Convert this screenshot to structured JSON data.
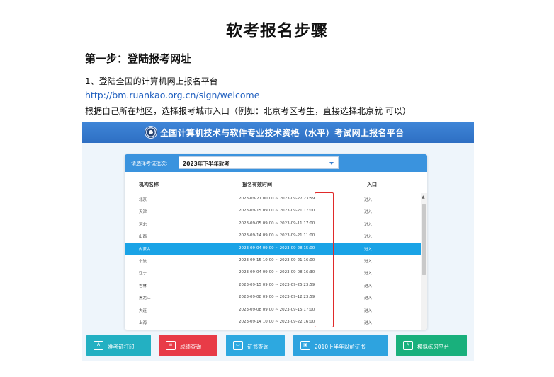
{
  "doc": {
    "title": "软考报名步骤",
    "step_heading": "第一步：登陆报考网址",
    "line1": "1、登陆全国的计算机网上报名平台",
    "link": "http://bm.ruankao.org.cn/sign/welcome",
    "line3": "根据自己所在地区，选择报考城市入口（例如：北京考区考生，直接选择北京就 可以）"
  },
  "screenshot": {
    "banner_title": "全国计算机技术与软件专业技术资格（水平）考试网上报名平台",
    "batch_label": "请选择考试批次:",
    "batch_value": "2023年下半年软考",
    "columns": {
      "org": "机构名称",
      "period": "报名有效时间",
      "entry": "入口"
    },
    "rows": [
      {
        "org": "北京",
        "period": "2023-09-21 00:00 ~ 2023-09-27 23:59",
        "entry": "进入"
      },
      {
        "org": "天津",
        "period": "2023-09-15 09:00 ~ 2023-09-21 17:00",
        "entry": "进入"
      },
      {
        "org": "河北",
        "period": "2023-09-05 09:00 ~ 2023-09-11 17:00",
        "entry": "进入"
      },
      {
        "org": "山西",
        "period": "2023-09-14 09:00 ~ 2023-09-21 11:00",
        "entry": "进入"
      },
      {
        "org": "内蒙古",
        "period": "2023-09-04 09:00 ~ 2023-09-28 15:00",
        "entry": "进入"
      },
      {
        "org": "宁波",
        "period": "2023-09-15 10:00 ~ 2023-09-21 16:00",
        "entry": "进入"
      },
      {
        "org": "辽宁",
        "period": "2023-09-04 09:00 ~ 2023-09-08 16:30",
        "entry": "进入"
      },
      {
        "org": "吉林",
        "period": "2023-09-15 09:00 ~ 2023-09-25 23:59",
        "entry": "进入"
      },
      {
        "org": "黑龙江",
        "period": "2023-09-08 09:00 ~ 2023-09-12 23:59",
        "entry": "进入"
      },
      {
        "org": "大连",
        "period": "2023-09-08 09:00 ~ 2023-09-15 17:00",
        "entry": "进入"
      },
      {
        "org": "上海",
        "period": "2023-09-14 10:00 ~ 2023-09-22 16:00",
        "entry": "进入"
      }
    ],
    "highlight_row_org": "内蒙古",
    "buttons": [
      {
        "icon": "admission-ticket-icon",
        "label": "准考证打印"
      },
      {
        "icon": "score-report-icon",
        "label": "成绩查询"
      },
      {
        "icon": "certificate-icon",
        "label": "证书查询"
      },
      {
        "icon": "certificate-id-icon",
        "label": "2010上半年以前证书"
      },
      {
        "icon": "practice-edit-icon",
        "label": "模拟练习平台"
      }
    ],
    "colors": {
      "banner": "#2e6fc3",
      "highlight_row": "#1aa3e6",
      "entry_box": "#e02a2a",
      "btn_teal": "#23b0c2",
      "btn_red": "#e83b47",
      "btn_blue": "#2da8e0",
      "btn_green": "#19b07c"
    }
  }
}
